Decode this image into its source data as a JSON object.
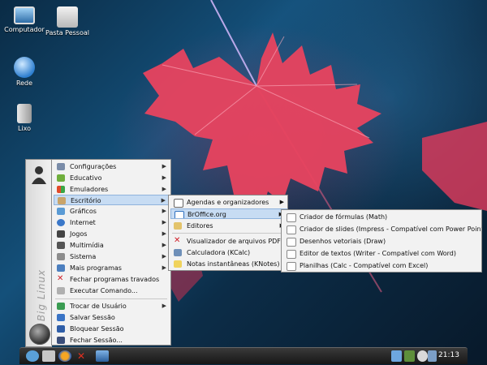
{
  "desktop": {
    "icons": [
      {
        "label": "Computador",
        "icon": "monitor-icon"
      },
      {
        "label": "Pasta Pessoal",
        "icon": "home-folder-icon"
      },
      {
        "label": "Rede",
        "icon": "network-globe-icon"
      },
      {
        "label": "Lixo",
        "icon": "trash-icon"
      }
    ]
  },
  "menu": {
    "brand": "Big Linux",
    "items": [
      {
        "label": "Configurações",
        "icon": "settings-icon",
        "submenu": true
      },
      {
        "label": "Educativo",
        "icon": "education-icon",
        "submenu": true
      },
      {
        "label": "Emuladores",
        "icon": "windows-icon",
        "submenu": true
      },
      {
        "label": "Escritório",
        "icon": "office-icon",
        "submenu": true,
        "selected": true
      },
      {
        "label": "Gráficos",
        "icon": "graphics-icon",
        "submenu": true
      },
      {
        "label": "Internet",
        "icon": "globe-icon",
        "submenu": true
      },
      {
        "label": "Jogos",
        "icon": "gamepad-icon",
        "submenu": true
      },
      {
        "label": "Multimídia",
        "icon": "multimedia-icon",
        "submenu": true
      },
      {
        "label": "Sistema",
        "icon": "system-icon",
        "submenu": true
      },
      {
        "label": "Mais programas",
        "icon": "more-programs-icon",
        "submenu": true
      },
      {
        "label": "Fechar programas travados",
        "icon": "close-x-icon",
        "submenu": false
      },
      {
        "label": "Executar Comando...",
        "icon": "run-icon",
        "submenu": false
      }
    ],
    "session": [
      {
        "label": "Trocar de Usuário",
        "icon": "switch-user-icon",
        "submenu": true
      },
      {
        "label": "Salvar Sessão",
        "icon": "save-session-icon",
        "submenu": false
      },
      {
        "label": "Bloquear Sessão",
        "icon": "lock-icon",
        "submenu": false
      },
      {
        "label": "Fechar Sessão...",
        "icon": "logout-icon",
        "submenu": false
      }
    ]
  },
  "office_submenu": [
    {
      "label": "Agendas e organizadores",
      "icon": "calendar-icon",
      "submenu": true
    },
    {
      "label": "BrOffice.org",
      "icon": "broffice-icon",
      "submenu": true,
      "selected": true
    },
    {
      "label": "Editores",
      "icon": "editor-icon",
      "submenu": true
    },
    {
      "label": "Visualizador de arquivos PDF (KPDF)",
      "icon": "pdf-icon",
      "submenu": false
    },
    {
      "label": "Calculadora (KCalc)",
      "icon": "calculator-icon",
      "submenu": false
    },
    {
      "label": "Notas instantâneas (KNotes)",
      "icon": "notes-icon",
      "submenu": false
    }
  ],
  "broffice_submenu": [
    {
      "label": "Criador de fórmulas (Math)",
      "icon": "math-icon"
    },
    {
      "label": "Criador de slides (Impress - Compatível com Power Point)",
      "icon": "impress-icon"
    },
    {
      "label": "Desenhos vetoriais (Draw)",
      "icon": "draw-icon"
    },
    {
      "label": "Editor de textos (Writer - Compatível com Word)",
      "icon": "writer-icon"
    },
    {
      "label": "Planilhas (Calc - Compatível com Excel)",
      "icon": "calc-icon"
    }
  ],
  "taskbar": {
    "clock": "21:13",
    "launchers": [
      "kmenu-icon",
      "home-icon",
      "firefox-icon",
      "tools-icon",
      "desktop-icon"
    ],
    "tray": [
      "network-tray-icon",
      "keyboard-tray-icon",
      "volume-tray-icon",
      "display-tray-icon"
    ]
  },
  "colors": {
    "selection": "#c7dcf3",
    "menu_bg": "#f2f2f2",
    "taskbar": "#1c1c1c",
    "leaf": "#e8435f"
  }
}
